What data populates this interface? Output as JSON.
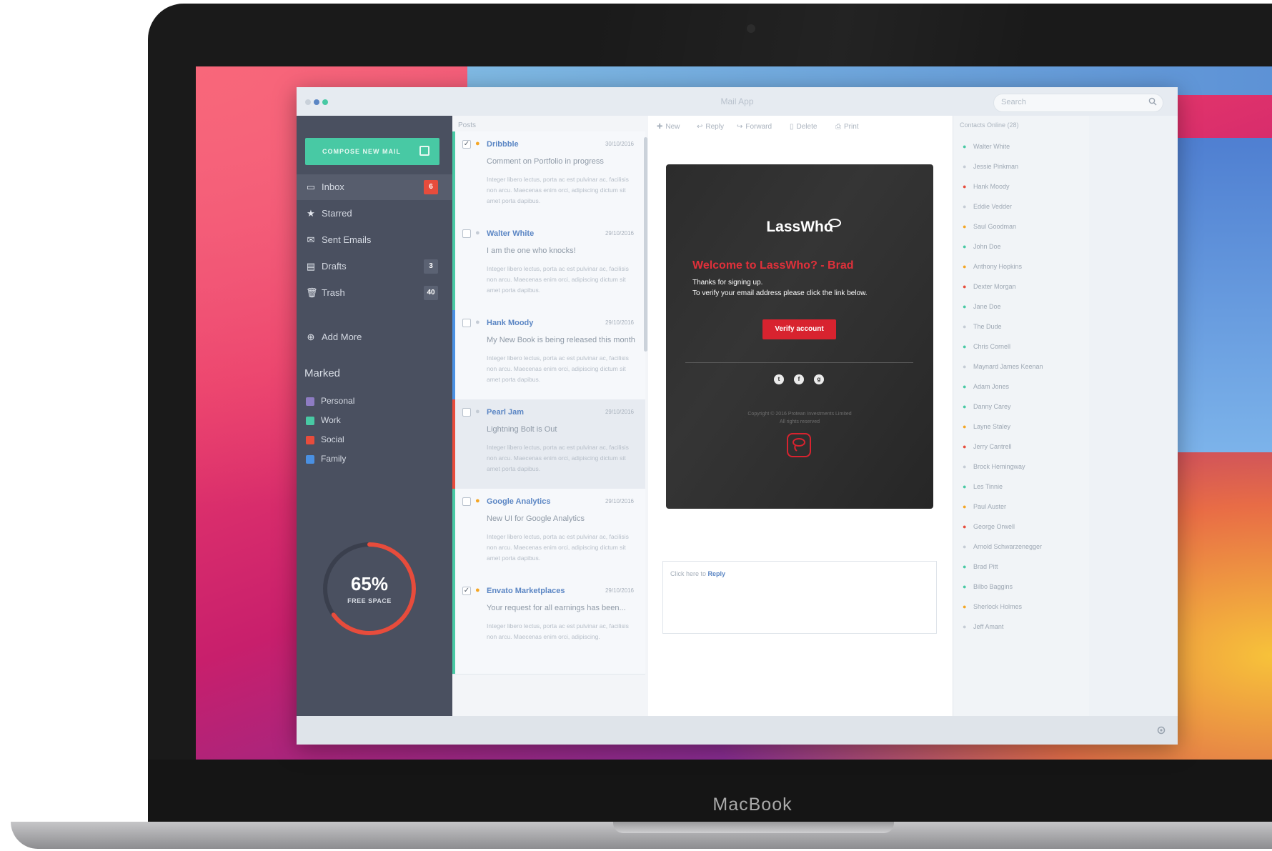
{
  "app": {
    "title": "Mail App",
    "search_placeholder": "Search"
  },
  "sidebar": {
    "compose_label": "COMPOSE NEW MAIL",
    "items": [
      {
        "label": "Inbox",
        "badge": "6",
        "badge_color": "#e74c3c",
        "icon": "inbox-icon",
        "active": true
      },
      {
        "label": "Starred",
        "badge": "",
        "icon": "star-icon",
        "active": false
      },
      {
        "label": "Sent Emails",
        "badge": "",
        "icon": "sent-icon",
        "active": false
      },
      {
        "label": "Drafts",
        "badge": "3",
        "badge_color": "#5b6273",
        "icon": "drafts-icon",
        "active": false
      },
      {
        "label": "Trash",
        "badge": "40",
        "badge_color": "#5b6273",
        "icon": "trash-icon",
        "active": false
      }
    ],
    "add_more_label": "Add More",
    "marked_title": "Marked",
    "labels": [
      {
        "label": "Personal",
        "color": "#8e7cc3"
      },
      {
        "label": "Work",
        "color": "#48c9a4"
      },
      {
        "label": "Social",
        "color": "#e74c3c"
      },
      {
        "label": "Family",
        "color": "#4a90e2"
      }
    ],
    "storage": {
      "value_text": "65%",
      "caption": "FREE SPACE",
      "fraction": 0.65,
      "color": "#e74c3c"
    }
  },
  "mail_list": {
    "header": "Posts",
    "items": [
      {
        "from": "Dribbble",
        "date": "30/10/2016",
        "subject": "Comment on Portfolio in progress",
        "excerpt": "Integer libero lectus, porta ac est pulvinar ac, facilisis non arcu. Maecenas enim orci, adipiscing dictum sit amet porta dapibus.",
        "checked": true,
        "starred": true,
        "bar_color": "#48c9a4",
        "selected": false
      },
      {
        "from": "Walter White",
        "date": "29/10/2016",
        "subject": "I am the one who knocks!",
        "excerpt": "Integer libero lectus, porta ac est pulvinar ac, facilisis non arcu. Maecenas enim orci, adipiscing dictum sit amet porta dapibus.",
        "checked": false,
        "starred": false,
        "bar_color": "#48c9a4",
        "selected": false
      },
      {
        "from": "Hank Moody",
        "date": "29/10/2016",
        "subject": "My New Book is being released this month",
        "excerpt": "Integer libero lectus, porta ac est pulvinar ac, facilisis non arcu. Maecenas enim orci, adipiscing dictum sit amet porta dapibus.",
        "checked": false,
        "starred": false,
        "bar_color": "#4a90e2",
        "selected": false
      },
      {
        "from": "Pearl Jam",
        "date": "29/10/2016",
        "subject": "Lightning Bolt is Out",
        "excerpt": "Integer libero lectus, porta ac est pulvinar ac, facilisis non arcu. Maecenas enim orci, adipiscing dictum sit amet porta dapibus.",
        "checked": false,
        "starred": false,
        "bar_color": "#e74c3c",
        "selected": true
      },
      {
        "from": "Google Analytics",
        "date": "29/10/2016",
        "subject": "New UI for Google Analytics",
        "excerpt": "Integer libero lectus, porta ac est pulvinar ac, facilisis non arcu. Maecenas enim orci, adipiscing dictum sit amet porta dapibus.",
        "checked": false,
        "starred": true,
        "bar_color": "#48c9a4",
        "selected": false
      },
      {
        "from": "Envato Marketplaces",
        "date": "29/10/2016",
        "subject": "Your request for all earnings has been...",
        "excerpt": "Integer libero lectus, porta ac est pulvinar ac, facilisis non arcu. Maecenas enim orci, adipiscing.",
        "checked": true,
        "starred": true,
        "bar_color": "#48c9a4",
        "selected": false
      }
    ]
  },
  "toolbar": {
    "new": "New",
    "reply": "Reply",
    "forward": "Forward",
    "delete": "Delete",
    "print": "Print"
  },
  "email": {
    "brand": "LassWho",
    "heading": "Welcome to LassWho? - Brad",
    "line1": "Thanks for signing up.",
    "line2": "To verify your email address please click the link below.",
    "button": "Verify account",
    "social": [
      "t",
      "f",
      "g"
    ],
    "copyright_line1": "Copyright © 2016 Protean Investments Limited",
    "copyright_line2": "All rights reserved",
    "accent": "#d8232f"
  },
  "reply": {
    "prefix": "Click here to ",
    "link": "Reply"
  },
  "contacts": {
    "header": "Contacts Online (28)",
    "items": [
      {
        "name": "Walter White",
        "status": "#48c9a4"
      },
      {
        "name": "Jessie Pinkman",
        "status": "#c5ccd5"
      },
      {
        "name": "Hank Moody",
        "status": "#e74c3c"
      },
      {
        "name": "Eddie Vedder",
        "status": "#c5ccd5"
      },
      {
        "name": "Saul Goodman",
        "status": "#f5a623"
      },
      {
        "name": "John Doe",
        "status": "#48c9a4"
      },
      {
        "name": "Anthony Hopkins",
        "status": "#f5a623"
      },
      {
        "name": "Dexter Morgan",
        "status": "#e74c3c"
      },
      {
        "name": "Jane Doe",
        "status": "#48c9a4"
      },
      {
        "name": "The Dude",
        "status": "#c5ccd5"
      },
      {
        "name": "Chris Cornell",
        "status": "#48c9a4"
      },
      {
        "name": "Maynard James Keenan",
        "status": "#c5ccd5"
      },
      {
        "name": "Adam Jones",
        "status": "#48c9a4"
      },
      {
        "name": "Danny Carey",
        "status": "#48c9a4"
      },
      {
        "name": "Layne Staley",
        "status": "#f5a623"
      },
      {
        "name": "Jerry Cantrell",
        "status": "#e74c3c"
      },
      {
        "name": "Brock Hemingway",
        "status": "#c5ccd5"
      },
      {
        "name": "Les Tinnie",
        "status": "#48c9a4"
      },
      {
        "name": "Paul Auster",
        "status": "#f5a623"
      },
      {
        "name": "George Orwell",
        "status": "#e74c3c"
      },
      {
        "name": "Arnold Schwarzenegger",
        "status": "#c5ccd5"
      },
      {
        "name": "Brad Pitt",
        "status": "#48c9a4"
      },
      {
        "name": "Bilbo Baggins",
        "status": "#48c9a4"
      },
      {
        "name": "Sherlock Holmes",
        "status": "#f5a623"
      },
      {
        "name": "Jeff Amant",
        "status": "#c5ccd5"
      }
    ]
  },
  "device": {
    "brand": "MacBook"
  }
}
